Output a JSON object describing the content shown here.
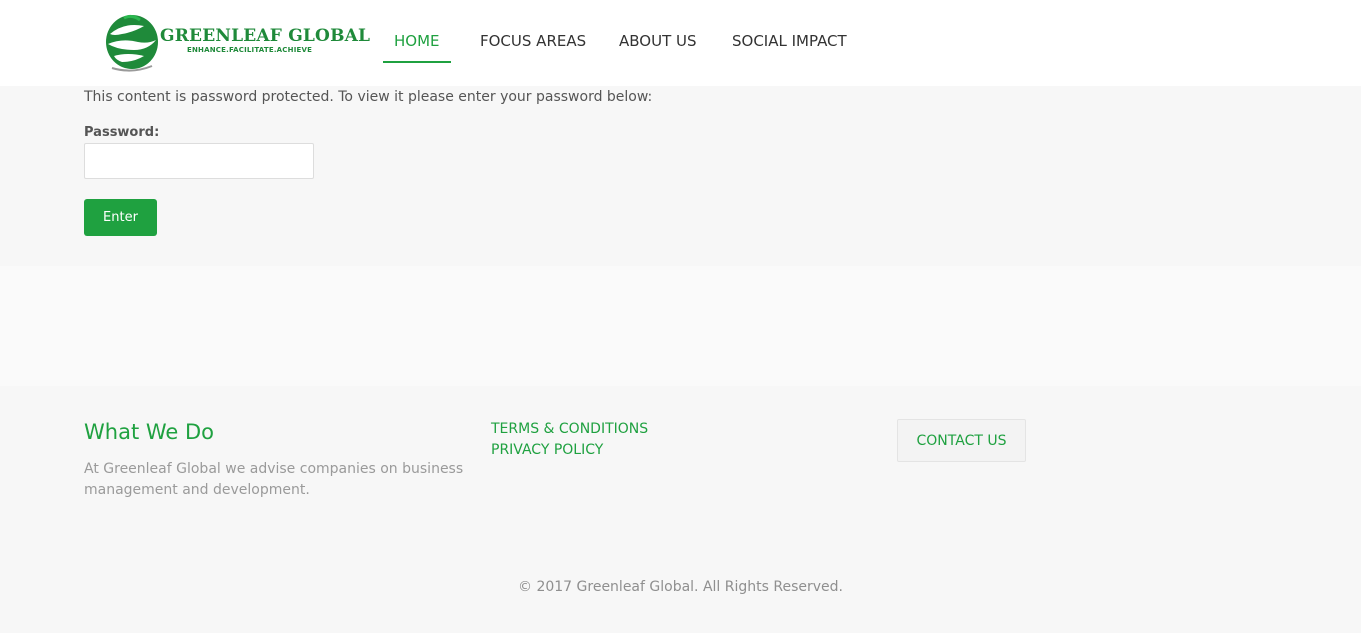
{
  "brand": {
    "name": "GREENLEAF GLOBAL",
    "tagline": "ENHANCE.FACILITATE.ACHIEVE",
    "color": "#1f8a3a"
  },
  "nav": {
    "items": [
      {
        "label": "HOME",
        "active": true
      },
      {
        "label": "FOCUS AREAS",
        "active": false
      },
      {
        "label": "ABOUT US",
        "active": false
      },
      {
        "label": "SOCIAL IMPACT",
        "active": false
      }
    ]
  },
  "protected": {
    "message": "This content is password protected. To view it please enter your password below:",
    "password_label": "Password:",
    "password_value": "",
    "enter_label": "Enter"
  },
  "footer": {
    "what_title": "What We Do",
    "what_text": "At Greenleaf Global we advise companies on business management and development.",
    "links": [
      "TERMS & CONDITIONS",
      "PRIVACY POLICY"
    ],
    "contact_label": "CONTACT US",
    "copyright": "© 2017 Greenleaf Global. All Rights Reserved."
  },
  "colors": {
    "accent": "#1fa140",
    "background": "#f7f7f7",
    "header": "#ffffff"
  }
}
